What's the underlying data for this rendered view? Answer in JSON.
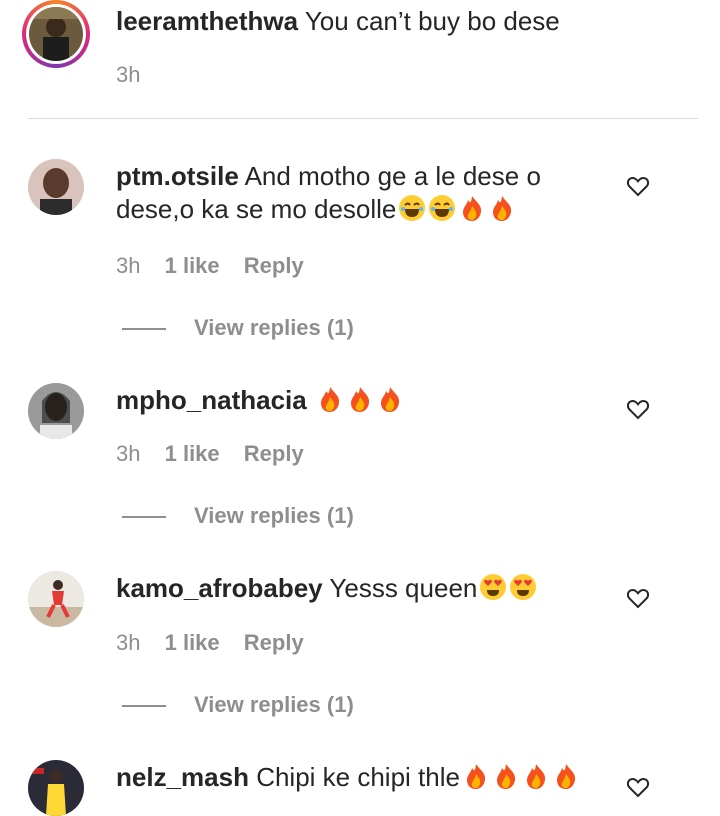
{
  "comments": [
    {
      "username": "leeramthethwa",
      "text": "You can’t buy bo dese",
      "time": "3h",
      "emojis": []
    },
    {
      "username": "ptm.otsile",
      "text": "And motho ge a le dese o dese,o ka se mo desolle",
      "emojis": [
        "laughing-emoji",
        "laughing-emoji",
        "fire-emoji",
        "fire-emoji"
      ],
      "time": "3h",
      "likes": "1 like",
      "reply": "Reply",
      "view_replies": "View replies (1)"
    },
    {
      "username": "mpho_nathacia",
      "text": "",
      "emojis": [
        "fire-emoji",
        "fire-emoji",
        "fire-emoji"
      ],
      "time": "3h",
      "likes": "1 like",
      "reply": "Reply",
      "view_replies": "View replies (1)"
    },
    {
      "username": "kamo_afrobabey",
      "text": "Yesss queen",
      "emojis": [
        "heart-eyes-emoji",
        "heart-eyes-emoji"
      ],
      "time": "3h",
      "likes": "1 like",
      "reply": "Reply",
      "view_replies": "View replies (1)"
    },
    {
      "username": "nelz_mash",
      "text": "Chipi ke chipi thle",
      "emojis": [
        "fire-emoji",
        "fire-emoji",
        "fire-emoji",
        "fire-emoji"
      ]
    }
  ],
  "colors": {
    "text": "#262626",
    "muted": "#8e8e8e",
    "divider": "#dbdbdb",
    "story_ring_start": "#f58529",
    "story_ring_end": "#dd2a7b"
  }
}
